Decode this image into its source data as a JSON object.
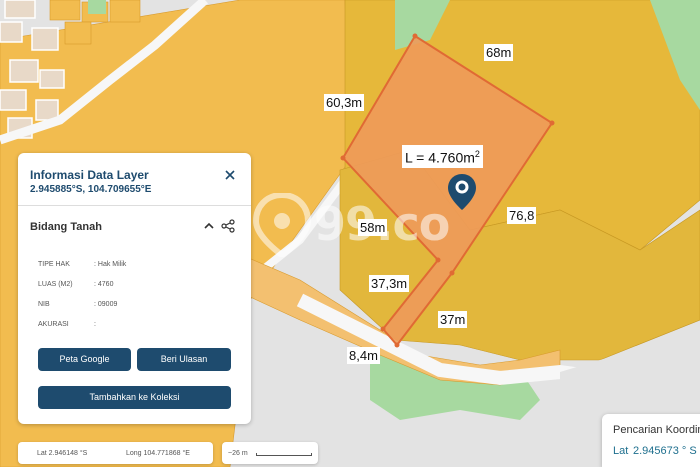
{
  "map": {
    "area_label": "L = 4.760m",
    "area_unit_sup": "2",
    "dimensions": [
      "68m",
      "60,3m",
      "76,8",
      "58m",
      "37,3m",
      "37m",
      "8,4m"
    ],
    "watermark": "99.co",
    "colors": {
      "parcel_fill": "#f2bc4f",
      "parcel_alt": "#e8b82f",
      "green_area": "#a7d9a0",
      "selected_fill": "#ee9a5a",
      "selected_stroke": "#e06a34",
      "road": "#f4f4f4"
    }
  },
  "info_panel": {
    "title": "Informasi Data Layer",
    "coords": "2.945885°S, 104.709655°E",
    "close_icon": "close-icon",
    "section_title": "Bidang Tanah",
    "attributes": [
      {
        "key": "TIPE HAK",
        "value": ": Hak Milik"
      },
      {
        "key": "LUAS (M2)",
        "value": ": 4760"
      },
      {
        "key": "NIB",
        "value": ": 09009"
      },
      {
        "key": "AKURASI",
        "value": ":"
      }
    ],
    "buttons": {
      "peta_google": "Peta Google",
      "beri_ulasan": "Beri Ulasan",
      "tambahkan": "Tambahkan ke Koleksi"
    },
    "accent": "#1e4b6e"
  },
  "coord_bar": {
    "lat": "Lat  2.946148 °S",
    "long": "Long  104.771868 °E"
  },
  "scale": {
    "text": "~26 m"
  },
  "search_panel": {
    "title": "Pencarian Koordinat",
    "lat_label": "Lat",
    "lat_value": "2.945673 ° S"
  }
}
